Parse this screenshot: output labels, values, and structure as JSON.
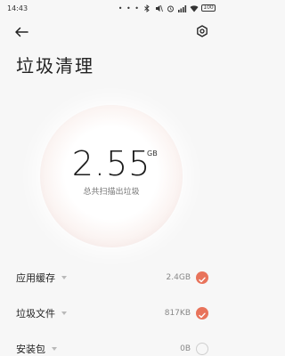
{
  "status": {
    "time": "14:43",
    "dots": "• • •",
    "battery": "100"
  },
  "header": {
    "title": "垃圾清理"
  },
  "summary": {
    "value": "2.55",
    "unit": "GB",
    "caption": "总共扫描出垃圾"
  },
  "items": [
    {
      "label": "应用缓存",
      "value": "2.4GB",
      "checked": true
    },
    {
      "label": "垃圾文件",
      "value": "817KB",
      "checked": true
    },
    {
      "label": "安装包",
      "value": "0B",
      "checked": false
    }
  ],
  "colors": {
    "accent": "#e8735b",
    "background": "#f7f7f7"
  }
}
